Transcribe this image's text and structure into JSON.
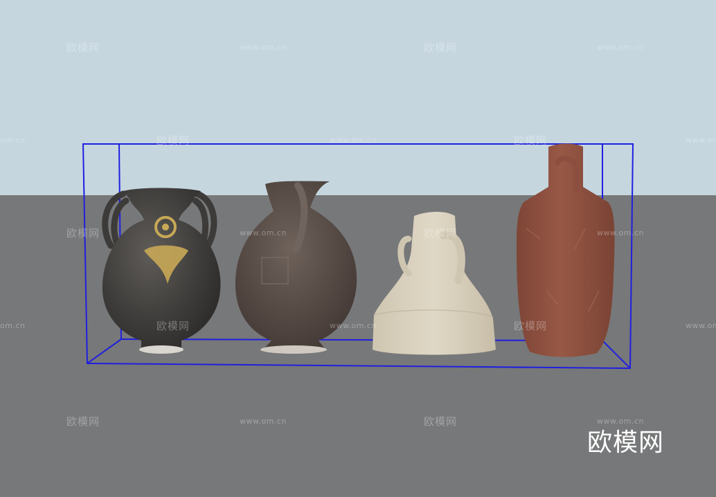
{
  "scene": {
    "sky_color": "#c5d6df",
    "ground_color": "#777879",
    "bbox_color": "#1f1fe0"
  },
  "objects": [
    {
      "name": "amphora",
      "color": "#4a4846"
    },
    {
      "name": "jug",
      "color": "#5d504a"
    },
    {
      "name": "clay-pot",
      "color": "#d6cdb8"
    },
    {
      "name": "bottle",
      "color": "#8a4a3a"
    }
  ],
  "watermark": {
    "cn": "欧模网",
    "url": "www.om.cn",
    "url_short": "om.cn",
    "url_light": "www.om.cn",
    "color": "rgba(255,255,255,0.32)"
  },
  "brand": {
    "label": "欧模网",
    "color": "#ffffff"
  }
}
